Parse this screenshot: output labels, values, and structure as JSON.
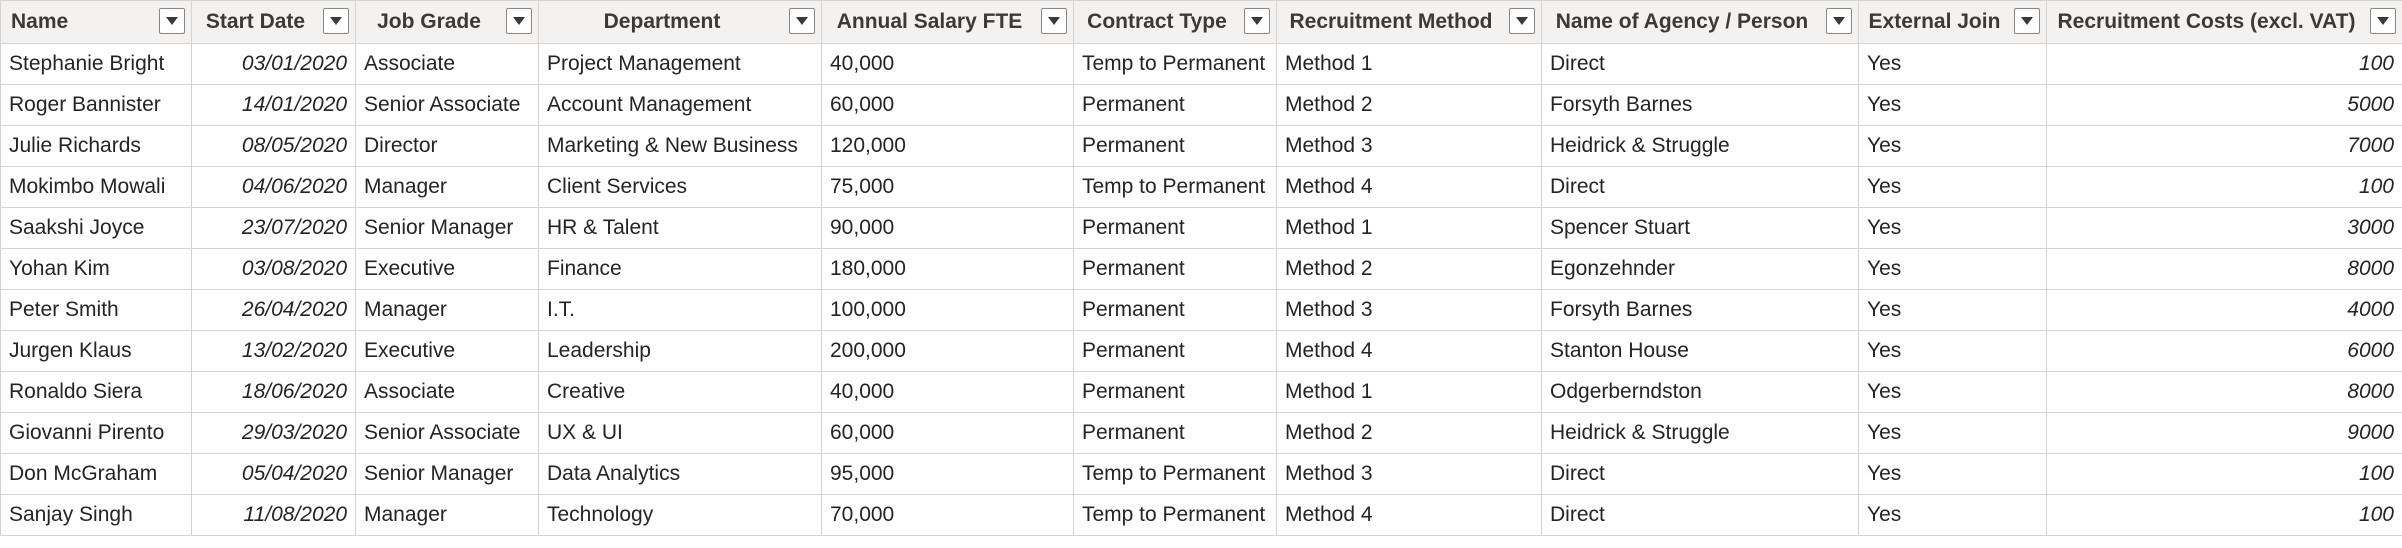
{
  "table": {
    "columns": [
      {
        "key": "name",
        "label": "Name"
      },
      {
        "key": "start_date",
        "label": "Start Date"
      },
      {
        "key": "job_grade",
        "label": "Job Grade"
      },
      {
        "key": "department",
        "label": "Department"
      },
      {
        "key": "salary",
        "label": "Annual Salary FTE"
      },
      {
        "key": "contract",
        "label": "Contract Type"
      },
      {
        "key": "method",
        "label": "Recruitment Method"
      },
      {
        "key": "agency",
        "label": "Name of Agency / Person"
      },
      {
        "key": "external",
        "label": "External Join"
      },
      {
        "key": "cost",
        "label": "Recruitment Costs (excl. VAT)"
      }
    ],
    "filter_icon": "chevron-down-icon",
    "rows": [
      {
        "name": "Stephanie Bright",
        "start_date": "03/01/2020",
        "job_grade": "Associate",
        "department": "Project Management",
        "salary": "40,000",
        "contract": "Temp to Permanent",
        "method": "Method 1",
        "agency": "Direct",
        "external": "Yes",
        "cost": "100"
      },
      {
        "name": "Roger Bannister",
        "start_date": "14/01/2020",
        "job_grade": "Senior Associate",
        "department": "Account Management",
        "salary": "60,000",
        "contract": "Permanent",
        "method": "Method 2",
        "agency": "Forsyth Barnes",
        "external": "Yes",
        "cost": "5000"
      },
      {
        "name": "Julie Richards",
        "start_date": "08/05/2020",
        "job_grade": "Director",
        "department": "Marketing & New Business",
        "salary": "120,000",
        "contract": "Permanent",
        "method": "Method 3",
        "agency": "Heidrick & Struggle",
        "external": "Yes",
        "cost": "7000"
      },
      {
        "name": "Mokimbo Mowali",
        "start_date": "04/06/2020",
        "job_grade": "Manager",
        "department": "Client Services",
        "salary": "75,000",
        "contract": "Temp to Permanent",
        "method": "Method 4",
        "agency": "Direct",
        "external": "Yes",
        "cost": "100"
      },
      {
        "name": "Saakshi Joyce",
        "start_date": "23/07/2020",
        "job_grade": "Senior Manager",
        "department": "HR & Talent",
        "salary": "90,000",
        "contract": "Permanent",
        "method": "Method 1",
        "agency": "Spencer Stuart",
        "external": "Yes",
        "cost": "3000"
      },
      {
        "name": "Yohan Kim",
        "start_date": "03/08/2020",
        "job_grade": "Executive",
        "department": "Finance",
        "salary": "180,000",
        "contract": "Permanent",
        "method": "Method 2",
        "agency": "Egonzehnder",
        "external": "Yes",
        "cost": "8000"
      },
      {
        "name": "Peter Smith",
        "start_date": "26/04/2020",
        "job_grade": "Manager",
        "department": "I.T.",
        "salary": "100,000",
        "contract": "Permanent",
        "method": "Method 3",
        "agency": "Forsyth Barnes",
        "external": "Yes",
        "cost": "4000"
      },
      {
        "name": "Jurgen Klaus",
        "start_date": "13/02/2020",
        "job_grade": "Executive",
        "department": "Leadership",
        "salary": "200,000",
        "contract": "Permanent",
        "method": "Method 4",
        "agency": "Stanton House",
        "external": "Yes",
        "cost": "6000"
      },
      {
        "name": "Ronaldo Siera",
        "start_date": "18/06/2020",
        "job_grade": "Associate",
        "department": "Creative",
        "salary": "40,000",
        "contract": "Permanent",
        "method": "Method 1",
        "agency": "Odgerberndston",
        "external": "Yes",
        "cost": "8000"
      },
      {
        "name": "Giovanni Pirento",
        "start_date": "29/03/2020",
        "job_grade": "Senior Associate",
        "department": "UX & UI",
        "salary": "60,000",
        "contract": "Permanent",
        "method": "Method 2",
        "agency": "Heidrick & Struggle",
        "external": "Yes",
        "cost": "9000"
      },
      {
        "name": "Don McGraham",
        "start_date": "05/04/2020",
        "job_grade": "Senior Manager",
        "department": "Data Analytics",
        "salary": "95,000",
        "contract": "Temp to Permanent",
        "method": "Method 3",
        "agency": "Direct",
        "external": "Yes",
        "cost": "100"
      },
      {
        "name": "Sanjay Singh",
        "start_date": "11/08/2020",
        "job_grade": "Manager",
        "department": "Technology",
        "salary": "70,000",
        "contract": "Temp to Permanent",
        "method": "Method 4",
        "agency": "Direct",
        "external": "Yes",
        "cost": "100"
      }
    ]
  }
}
